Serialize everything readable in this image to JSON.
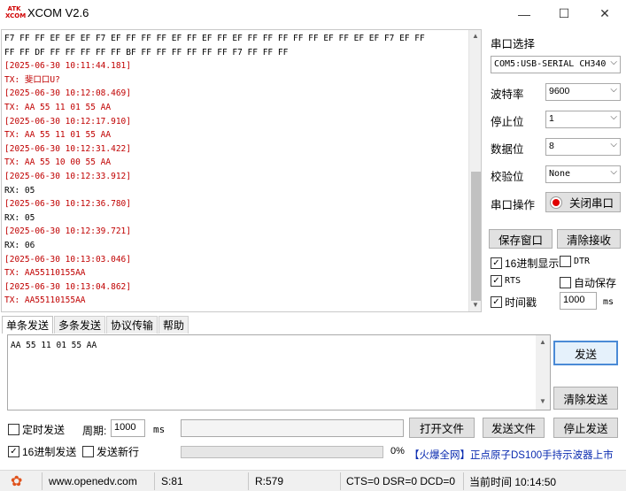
{
  "app": {
    "title": "XCOM V2.6",
    "logo_line1": "ATK",
    "logo_line2": "XCOM"
  },
  "window_controls": {
    "minimize": "—",
    "maximize": "☐",
    "close": "✕"
  },
  "receive_lines": [
    {
      "kind": "data",
      "text": "F7 FF FF EF EF EF F7 EF FF FF FF EF FF EF FF EF FF FF FF FF FF EF FF EF EF F7 EF FF"
    },
    {
      "kind": "data",
      "text": "FF FF DF FF FF FF FF FF BF FF FF FF FF FF FF F7 FF FF FF"
    },
    {
      "kind": "ts",
      "text": "[2025-06-30 10:11:44.181]"
    },
    {
      "kind": "tx",
      "text": "TX: 斐口口U?"
    },
    {
      "kind": "ts",
      "text": "[2025-06-30 10:12:08.469]"
    },
    {
      "kind": "tx",
      "text": "TX: AA 55 11 01 55 AA"
    },
    {
      "kind": "ts",
      "text": "[2025-06-30 10:12:17.910]"
    },
    {
      "kind": "tx",
      "text": "TX: AA 55 11 01 55 AA"
    },
    {
      "kind": "ts",
      "text": "[2025-06-30 10:12:31.422]"
    },
    {
      "kind": "tx",
      "text": "TX: AA 55 10 00 55 AA"
    },
    {
      "kind": "ts",
      "text": "[2025-06-30 10:12:33.912]"
    },
    {
      "kind": "rx",
      "text": "RX: 05"
    },
    {
      "kind": "ts",
      "text": "[2025-06-30 10:12:36.780]"
    },
    {
      "kind": "rx",
      "text": "RX: 05"
    },
    {
      "kind": "ts",
      "text": "[2025-06-30 10:12:39.721]"
    },
    {
      "kind": "rx",
      "text": "RX: 06"
    },
    {
      "kind": "ts",
      "text": "[2025-06-30 10:13:03.046]"
    },
    {
      "kind": "tx",
      "text": "TX: AA55110155AA"
    },
    {
      "kind": "ts",
      "text": "[2025-06-30 10:13:04.862]"
    },
    {
      "kind": "tx",
      "text": "TX: AA55110155AA"
    }
  ],
  "serial": {
    "port_label": "串口选择",
    "port_value": "COM5:USB-SERIAL CH340",
    "baud_label": "波特率",
    "baud_value": "9600",
    "stop_label": "停止位",
    "stop_value": "1",
    "data_label": "数据位",
    "data_value": "8",
    "parity_label": "校验位",
    "parity_value": "None",
    "op_label": "串口操作",
    "close_port_button": "关闭串口"
  },
  "rx_options": {
    "save_window_button": "保存窗口",
    "clear_receive_button": "清除接收",
    "hex_display_label": "16进制显示",
    "hex_display_checked": true,
    "dtr_label": "DTR",
    "dtr_checked": false,
    "rts_label": "RTS",
    "rts_checked": true,
    "auto_save_label": "自动保存",
    "auto_save_checked": false,
    "timestamp_label": "时间戳",
    "timestamp_checked": true,
    "timestamp_ms": "1000",
    "ms_unit": "ms"
  },
  "tabs": [
    "单条发送",
    "多条发送",
    "协议传输",
    "帮助"
  ],
  "send": {
    "input_value": "AA 55 11 01 55 AA",
    "send_button": "发送",
    "clear_send_button": "清除发送",
    "timed_send_label": "定时发送",
    "timed_send_checked": false,
    "period_label": "周期:",
    "period_value": "1000",
    "period_unit": "ms",
    "file_path": "",
    "open_file_button": "打开文件",
    "send_file_button": "发送文件",
    "stop_send_button": "停止发送",
    "hex_send_label": "16进制发送",
    "hex_send_checked": true,
    "newline_label": "发送新行",
    "newline_checked": false,
    "progress_percent": "0%",
    "ad_text": "【火爆全网】正点原子DS100手持示波器上市"
  },
  "status": {
    "url": "www.openedv.com",
    "sent": "S:81",
    "received": "R:579",
    "lines": "CTS=0 DSR=0 DCD=0",
    "time": "当前时间 10:14:50"
  }
}
